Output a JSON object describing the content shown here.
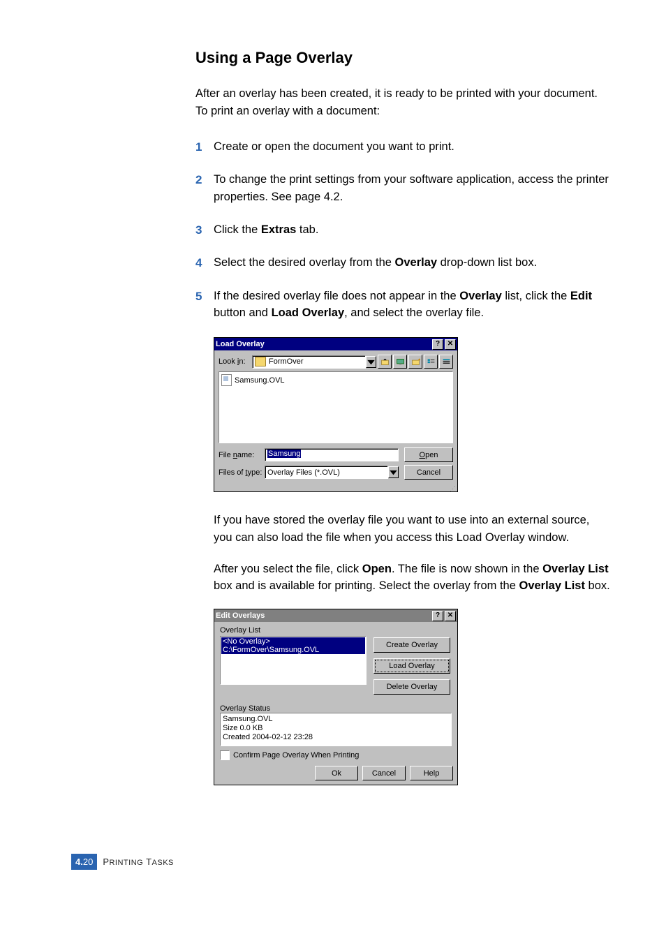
{
  "heading": "Using a Page Overlay",
  "intro": "After an overlay has been created, it is ready to be printed with your document. To print an overlay with a document:",
  "steps": {
    "s1_num": "1",
    "s1_text": "Create or open the document you want to print.",
    "s2_num": "2",
    "s2_text": "To change the print settings from your software application, access the printer properties. See page 4.2.",
    "s3_num": "3",
    "s3_a": "Click the ",
    "s3_bold": "Extras",
    "s3_b": " tab.",
    "s4_num": "4",
    "s4_a": "Select the desired overlay from the ",
    "s4_bold": "Overlay",
    "s4_b": " drop-down list box.",
    "s5_num": "5",
    "s5_a": "If the desired overlay file does not appear in the ",
    "s5_bold1": "Overlay",
    "s5_b": " list, click the ",
    "s5_bold2": "Edit",
    "s5_c": " button and ",
    "s5_bold3": "Load Overlay",
    "s5_d": ", and select the overlay file."
  },
  "loadDlg": {
    "title": "Load Overlay",
    "helpGlyph": "?",
    "closeGlyph": "✕",
    "lookin_lbl": "Look in:",
    "lookin_lbl_und": "i",
    "lookin_val": "FormOver",
    "file_item": "Samsung.OVL",
    "filename_lbl": "File name:",
    "filename_lbl_und": "n",
    "filename_val": "Samsung",
    "filetype_lbl": "Files of type:",
    "filetype_lbl_und": "t",
    "filetype_val": "Overlay Files (*.OVL)",
    "open_btn": "Open",
    "open_btn_und": "O",
    "cancel_btn": "Cancel"
  },
  "midpara1": "If you have stored the overlay file you want to use into an external source, you can also load the file when you access this Load Overlay window.",
  "midpara2_a": "After you select the file, click ",
  "midpara2_b1": "Open",
  "midpara2_b": ". The file is now shown in the ",
  "midpara2_b2": "Overlay List",
  "midpara2_c": " box and is available for printing. Select the overlay from the ",
  "midpara2_b3": "Overlay List",
  "midpara2_d": " box.",
  "editDlg": {
    "title": "Edit Overlays",
    "helpGlyph": "?",
    "closeGlyph": "✕",
    "list_label": "Overlay List",
    "list_item1": "<No Overlay>",
    "list_item2": "C:\\FormOver\\Samsung.OVL",
    "btn_create": "Create Overlay",
    "btn_load": "Load Overlay",
    "btn_delete": "Delete Overlay",
    "status_label": "Overlay Status",
    "status_l1": "Samsung.OVL",
    "status_l2": "Size 0.0 KB",
    "status_l3": "Created 2004-02-12 23:28",
    "confirm_label": "Confirm Page Overlay When Printing",
    "btn_ok": "Ok",
    "btn_cancel": "Cancel",
    "btn_help": "Help"
  },
  "footer": {
    "chapter": "4.",
    "page": "20",
    "section": "Printing Tasks"
  }
}
